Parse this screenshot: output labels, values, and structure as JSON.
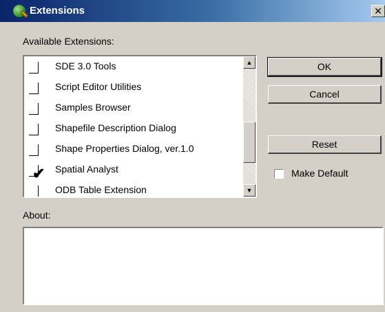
{
  "window": {
    "title": "Extensions",
    "close_glyph": "✕"
  },
  "labels": {
    "available": "Available Extensions:",
    "about": "About:"
  },
  "extensions": [
    {
      "label": "SDE 3.0 Tools",
      "checked": false
    },
    {
      "label": "Script Editor Utilities",
      "checked": false
    },
    {
      "label": "Samples Browser",
      "checked": false
    },
    {
      "label": "Shapefile Description Dialog",
      "checked": false
    },
    {
      "label": "Shape Properties Dialog, ver.1.0",
      "checked": false
    },
    {
      "label": "Spatial Analyst",
      "checked": true
    },
    {
      "label": "ODB Table Extension",
      "checked": false
    }
  ],
  "buttons": {
    "ok": "OK",
    "cancel": "Cancel",
    "reset": "Reset"
  },
  "make_default": {
    "label": "Make Default",
    "checked": false
  },
  "about_text": "",
  "scrollbar": {
    "up_glyph": "▲",
    "down_glyph": "▼"
  },
  "colors": {
    "titlebar_start": "#0a246a",
    "titlebar_end": "#a6caf0",
    "face": "#d4d0c8"
  },
  "icons": {
    "app": "globe-magnifier-icon",
    "check": "checkmark-icon"
  }
}
